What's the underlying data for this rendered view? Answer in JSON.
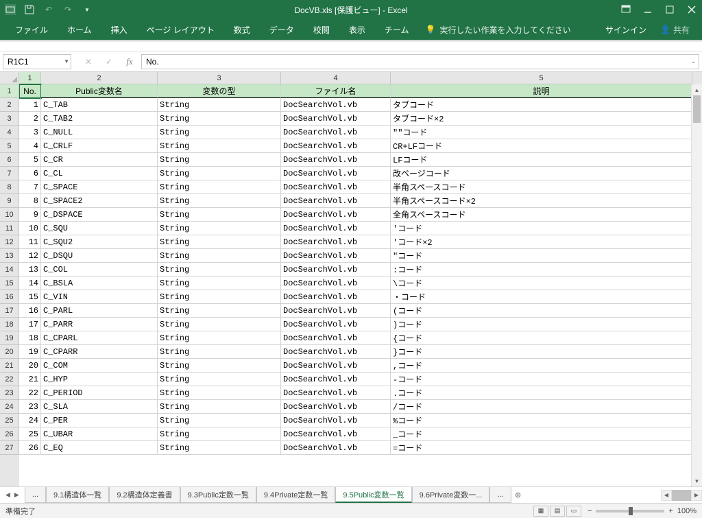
{
  "title": "DocVB.xls  [保護ビュー] - Excel",
  "ribbon": {
    "tabs": [
      "ファイル",
      "ホーム",
      "挿入",
      "ページ レイアウト",
      "数式",
      "データ",
      "校閲",
      "表示",
      "チーム"
    ],
    "tellme": "実行したい作業を入力してください",
    "signin": "サインイン",
    "share": "共有"
  },
  "formulabar": {
    "namebox": "R1C1",
    "formula": "No."
  },
  "columns": [
    "1",
    "2",
    "3",
    "4",
    "5"
  ],
  "headers": [
    "No.",
    "Public変数名",
    "変数の型",
    "ファイル名",
    "説明"
  ],
  "rows": [
    {
      "n": "1",
      "name": "C_TAB",
      "type": "String",
      "file": "DocSearchVol.vb",
      "desc": "タブコード"
    },
    {
      "n": "2",
      "name": "C_TAB2",
      "type": "String",
      "file": "DocSearchVol.vb",
      "desc": "タブコード×2"
    },
    {
      "n": "3",
      "name": "C_NULL",
      "type": "String",
      "file": "DocSearchVol.vb",
      "desc": "\"\"コード"
    },
    {
      "n": "4",
      "name": "C_CRLF",
      "type": "String",
      "file": "DocSearchVol.vb",
      "desc": "CR+LFコード"
    },
    {
      "n": "5",
      "name": "C_CR",
      "type": "String",
      "file": "DocSearchVol.vb",
      "desc": "LFコード"
    },
    {
      "n": "6",
      "name": "C_CL",
      "type": "String",
      "file": "DocSearchVol.vb",
      "desc": "改ページコード"
    },
    {
      "n": "7",
      "name": "C_SPACE",
      "type": "String",
      "file": "DocSearchVol.vb",
      "desc": "半角スペースコード"
    },
    {
      "n": "8",
      "name": "C_SPACE2",
      "type": "String",
      "file": "DocSearchVol.vb",
      "desc": "半角スペースコード×2"
    },
    {
      "n": "9",
      "name": "C_DSPACE",
      "type": "String",
      "file": "DocSearchVol.vb",
      "desc": "全角スペースコード"
    },
    {
      "n": "10",
      "name": "C_SQU",
      "type": "String",
      "file": "DocSearchVol.vb",
      "desc": "'コード"
    },
    {
      "n": "11",
      "name": "C_SQU2",
      "type": "String",
      "file": "DocSearchVol.vb",
      "desc": "'コード×2"
    },
    {
      "n": "12",
      "name": "C_DSQU",
      "type": "String",
      "file": "DocSearchVol.vb",
      "desc": "\"コード"
    },
    {
      "n": "13",
      "name": "C_COL",
      "type": "String",
      "file": "DocSearchVol.vb",
      "desc": ":コード"
    },
    {
      "n": "14",
      "name": "C_BSLA",
      "type": "String",
      "file": "DocSearchVol.vb",
      "desc": "\\コード"
    },
    {
      "n": "15",
      "name": "C_VIN",
      "type": "String",
      "file": "DocSearchVol.vb",
      "desc": "・コード"
    },
    {
      "n": "16",
      "name": "C_PARL",
      "type": "String",
      "file": "DocSearchVol.vb",
      "desc": "(コード"
    },
    {
      "n": "17",
      "name": "C_PARR",
      "type": "String",
      "file": "DocSearchVol.vb",
      "desc": ")コード"
    },
    {
      "n": "18",
      "name": "C_CPARL",
      "type": "String",
      "file": "DocSearchVol.vb",
      "desc": "{コード"
    },
    {
      "n": "19",
      "name": "C_CPARR",
      "type": "String",
      "file": "DocSearchVol.vb",
      "desc": "}コード"
    },
    {
      "n": "20",
      "name": "C_COM",
      "type": "String",
      "file": "DocSearchVol.vb",
      "desc": ",コード"
    },
    {
      "n": "21",
      "name": "C_HYP",
      "type": "String",
      "file": "DocSearchVol.vb",
      "desc": " -コード"
    },
    {
      "n": "22",
      "name": "C_PERIOD",
      "type": "String",
      "file": "DocSearchVol.vb",
      "desc": ".コード"
    },
    {
      "n": "23",
      "name": "C_SLA",
      "type": "String",
      "file": "DocSearchVol.vb",
      "desc": "/コード"
    },
    {
      "n": "24",
      "name": "C_PER",
      "type": "String",
      "file": "DocSearchVol.vb",
      "desc": "%コード"
    },
    {
      "n": "25",
      "name": "C_UBAR",
      "type": "String",
      "file": "DocSearchVol.vb",
      "desc": "_コード"
    },
    {
      "n": "26",
      "name": "C_EQ",
      "type": "String",
      "file": "DocSearchVol.vb",
      "desc": " =コード"
    }
  ],
  "sheettabs": {
    "ellipsis": "...",
    "items": [
      "9.1構造体一覧",
      "9.2構造体定義書",
      "9.3Public定数一覧",
      "9.4Private定数一覧",
      "9.5Public変数一覧",
      "9.6Private変数一..."
    ],
    "activeIndex": 4
  },
  "status": {
    "ready": "準備完了",
    "zoom": "100%"
  }
}
